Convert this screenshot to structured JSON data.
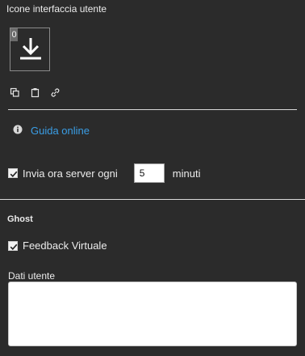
{
  "section": {
    "title": "Icone interfaccia utente"
  },
  "icon_tile": {
    "index": "0",
    "icon": "download-icon"
  },
  "tools": [
    {
      "icon": "copy-icon"
    },
    {
      "icon": "clipboard-icon"
    },
    {
      "icon": "link-icon"
    }
  ],
  "help": {
    "icon": "info-icon",
    "label": "Guida online"
  },
  "server": {
    "checked": true,
    "label": "Invia ora server ogni",
    "value": "5",
    "unit": "minuti"
  },
  "ghost": {
    "title": "Ghost",
    "feedback_checked": true,
    "feedback_label": "Feedback Virtuale"
  },
  "user_data": {
    "label": "Dati utente",
    "value": ""
  },
  "colors": {
    "background": "#2b2b2b",
    "text": "#e6e6e6",
    "link": "#3a9ee6",
    "divider": "#d9d9d9"
  }
}
